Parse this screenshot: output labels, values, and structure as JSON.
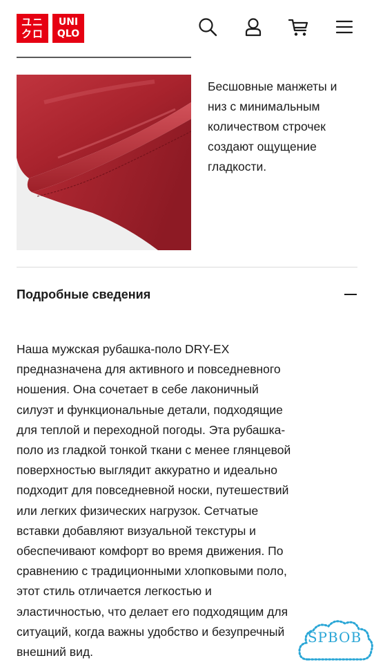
{
  "header": {
    "logo": {
      "top_text": "ユニ",
      "bottom_text": "クロ",
      "top_text_right": "UNI",
      "bottom_text_right": "QLO",
      "brand_color": "#e60012"
    },
    "icons": [
      "search-icon",
      "account-icon",
      "cart-icon",
      "menu-icon"
    ]
  },
  "feature": {
    "image": "red-fabric-hem-photo",
    "text": "Бесшовные манжеты и\nниз с минимальным\nколичеством строчек\nсоздают ощущение\nгладкости."
  },
  "details": {
    "title": "Подробные сведения",
    "toggle_icon": "minus-icon",
    "body": "Наша мужская рубашка-поло DRY-EX\nпредназначена для активного и повседневного\nношения. Она сочетает в себе лаконичный\nсилуэт и функциональные детали, подходящие\nдля теплой и переходной погоды. Эта рубашка-\nполо из гладкой тонкой ткани с менее глянцевой\nповерхностью выглядит аккуратно и идеально\nподходит для повседневной носки, путешествий\nили легких физических нагрузок. Сетчатые\nвставки добавляют визуальной текстуры и\nобеспечивают комфорт во время движения. По\nсравнению с традиционными хлопковыми поло,\nэтот стиль отличается легкостью и\nэластичностью, что делает его подходящим для\nситуаций, когда важны удобство и безупречный\nвнешний вид."
  },
  "watermark": {
    "text": "SPBOB",
    "color": "#29a6d6"
  }
}
